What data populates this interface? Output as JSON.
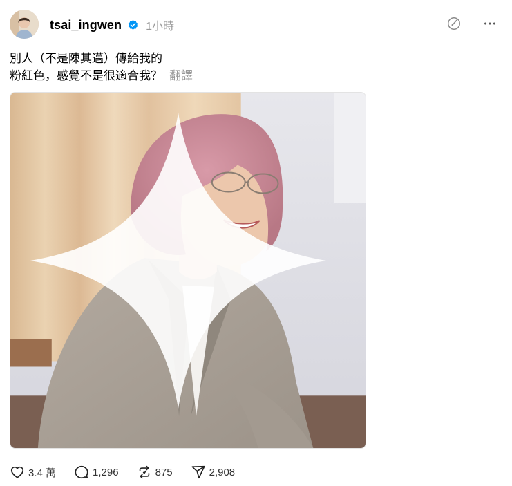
{
  "post": {
    "username": "tsai_ingwen",
    "time": "1小時",
    "text_line1": "別人（不是陳其邁）傳給我的",
    "text_line2": "粉紅色，感覺不是很適合我？",
    "translate_label": "翻譯"
  },
  "stats": {
    "likes": "3.4 萬",
    "comments": "1,296",
    "reposts": "875",
    "shares": "2,908"
  },
  "icons": {
    "verified": "verified-badge-icon",
    "top_action": "feed-icon",
    "more": "more-icon",
    "like": "heart-icon",
    "comment": "comment-icon",
    "repost": "repost-icon",
    "share": "share-icon",
    "ai": "sparkle-icon"
  },
  "colors": {
    "verified": "#0095f6",
    "muted": "#999999"
  }
}
